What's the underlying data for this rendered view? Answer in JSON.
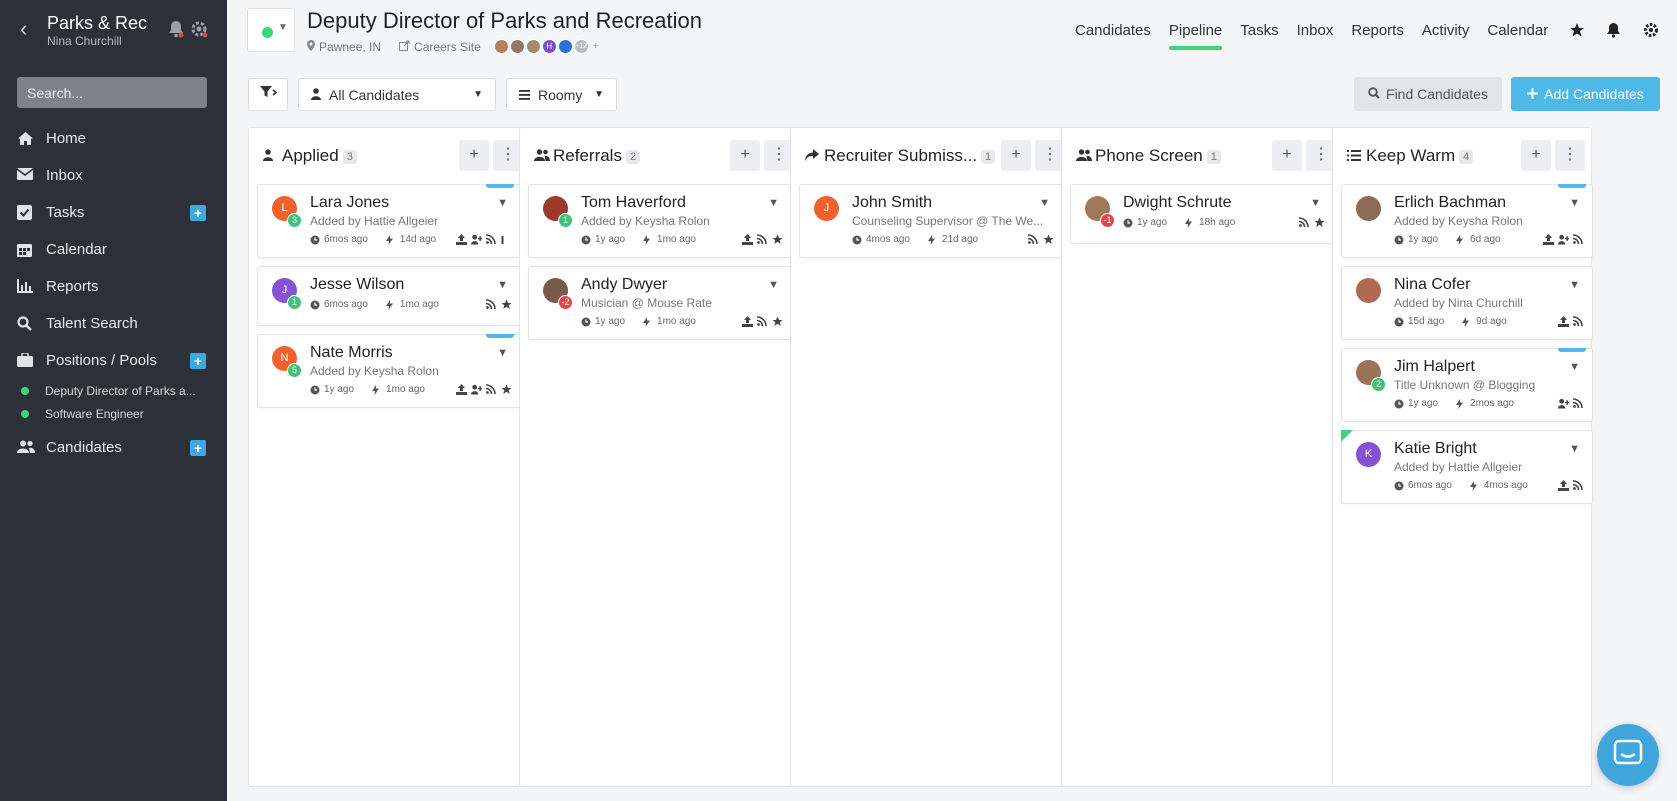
{
  "sidebar": {
    "org_name": "Parks & Rec",
    "user_name": "Nina Churchill",
    "search_placeholder": "Search...",
    "items": [
      {
        "label": "Home",
        "icon": "home-icon"
      },
      {
        "label": "Inbox",
        "icon": "envelope-icon"
      },
      {
        "label": "Tasks",
        "icon": "checkbox-icon",
        "plus": "+"
      },
      {
        "label": "Calendar",
        "icon": "calendar-icon"
      },
      {
        "label": "Reports",
        "icon": "bar-chart-icon"
      },
      {
        "label": "Talent Search",
        "icon": "search-icon"
      },
      {
        "label": "Positions / Pools",
        "icon": "briefcase-icon",
        "plus": "+"
      },
      {
        "label": "Candidates",
        "icon": "users-icon",
        "plus": "+"
      }
    ],
    "positions": [
      {
        "label": "Deputy Director of Parks a...",
        "color": "#3fd37c"
      },
      {
        "label": "Software Engineer",
        "color": "#3fd37c"
      }
    ]
  },
  "header": {
    "title": "Deputy Director of Parks and Recreation",
    "location": "Pawnee, IN",
    "careers_link": "Careers Site",
    "more_count": "+12",
    "plus": "+",
    "hiring_team_avatars": [
      {
        "initial": "",
        "color": "#b5825f"
      },
      {
        "initial": "",
        "color": "#8f7a6a"
      },
      {
        "initial": "",
        "color": "#a08a74"
      },
      {
        "initial": "H",
        "color": "#7b4fcf"
      },
      {
        "initial": "",
        "color": "#2f6fd6"
      }
    ],
    "nav": [
      "Candidates",
      "Pipeline",
      "Tasks",
      "Inbox",
      "Reports",
      "Activity",
      "Calendar"
    ],
    "active_nav": "Pipeline"
  },
  "toolbar": {
    "candidate_filter": "All Candidates",
    "density": "Roomy",
    "find_candidates": "Find Candidates",
    "add_candidates": "Add Candidates"
  },
  "columns": [
    {
      "name": "Applied",
      "count": "3",
      "icon": "user-icon",
      "cards": [
        {
          "name": "Lara Jones",
          "sub": "Added by Hattie Allgeier",
          "initial": "L",
          "avatar_color": "#f0622d",
          "badge": "3",
          "badge_color": "#3fc37a",
          "time1": "6mos ago",
          "time2": "14d ago",
          "tag": true,
          "icons": [
            "upload-icon",
            "user-plus-icon",
            "rss-icon",
            "more-icon"
          ]
        },
        {
          "name": "Jesse Wilson",
          "sub": "",
          "initial": "J",
          "avatar_color": "#8752d1",
          "badge": "1",
          "badge_color": "#3fc37a",
          "time1": "6mos ago",
          "time2": "1mo ago",
          "tag": false,
          "icons": [
            "rss-icon",
            "star-icon"
          ]
        },
        {
          "name": "Nate Morris",
          "sub": "Added by Keysha Rolon",
          "initial": "N",
          "avatar_color": "#f0622d",
          "badge": "5",
          "badge_color": "#3fc37a",
          "time1": "1y ago",
          "time2": "1mo ago",
          "tag": true,
          "icons": [
            "upload-icon",
            "user-plus-icon",
            "rss-icon",
            "star-icon"
          ]
        }
      ]
    },
    {
      "name": "Referrals",
      "count": "2",
      "icon": "users-icon",
      "cards": [
        {
          "name": "Tom Haverford",
          "sub": "Added by Keysha Rolon",
          "initial": "",
          "avatar_color": "#9c3a2e",
          "badge": "1",
          "badge_color": "#3fc37a",
          "time1": "1y ago",
          "time2": "1mo ago",
          "tag": false,
          "icons": [
            "upload-icon",
            "rss-icon",
            "star-icon"
          ]
        },
        {
          "name": "Andy Dwyer",
          "sub": "Musician @ Mouse Rate",
          "initial": "",
          "avatar_color": "#7a5a48",
          "badge": "-2",
          "badge_color": "#e0464e",
          "time1": "1y ago",
          "time2": "1mo ago",
          "tag": false,
          "icons": [
            "upload-icon",
            "rss-icon",
            "star-icon"
          ]
        }
      ]
    },
    {
      "name": "Recruiter Submiss...",
      "count": "1",
      "icon": "share-icon",
      "cards": [
        {
          "name": "John Smith",
          "sub": "Counseling Supervisor @ The We...",
          "initial": "J",
          "avatar_color": "#f0622d",
          "badge": "",
          "badge_color": "",
          "time1": "4mos ago",
          "time2": "21d ago",
          "tag": false,
          "icons": [
            "rss-icon",
            "star-icon"
          ]
        }
      ]
    },
    {
      "name": "Phone Screen",
      "count": "1",
      "icon": "users-icon",
      "cards": [
        {
          "name": "Dwight Schrute",
          "sub": "",
          "initial": "",
          "avatar_color": "#a07a58",
          "badge": "-1",
          "badge_color": "#e0464e",
          "time1": "1y ago",
          "time2": "18h ago",
          "tag": false,
          "icons": [
            "rss-icon",
            "star-icon"
          ]
        }
      ]
    },
    {
      "name": "Keep Warm",
      "count": "4",
      "icon": "list-icon",
      "cards": [
        {
          "name": "Erlich Bachman",
          "sub": "Added by Keysha Rolon",
          "initial": "",
          "avatar_color": "#8a6b55",
          "badge": "",
          "badge_color": "",
          "time1": "1y ago",
          "time2": "6d ago",
          "tag": true,
          "icons": [
            "upload-icon",
            "user-plus-icon",
            "rss-icon"
          ]
        },
        {
          "name": "Nina Cofer",
          "sub": "Added by Nina Churchill",
          "initial": "",
          "avatar_color": "#b06a52",
          "badge": "",
          "badge_color": "",
          "time1": "15d ago",
          "time2": "9d ago",
          "tag": false,
          "icons": [
            "upload-icon",
            "rss-icon"
          ]
        },
        {
          "name": "Jim Halpert",
          "sub": "Title Unknown @ Blogging",
          "initial": "",
          "avatar_color": "#9a7258",
          "badge": "2",
          "badge_color": "#3fc37a",
          "time1": "1y ago",
          "time2": "2mos ago",
          "tag": true,
          "icons": [
            "user-plus-icon",
            "rss-icon"
          ]
        },
        {
          "name": "Katie Bright",
          "sub": "Added by Hattie Allgeier",
          "initial": "K",
          "avatar_color": "#8752d1",
          "badge": "",
          "badge_color": "",
          "time1": "6mos ago",
          "time2": "4mos ago",
          "tag": false,
          "corner": true,
          "icons": [
            "upload-icon",
            "rss-icon"
          ]
        }
      ]
    }
  ]
}
